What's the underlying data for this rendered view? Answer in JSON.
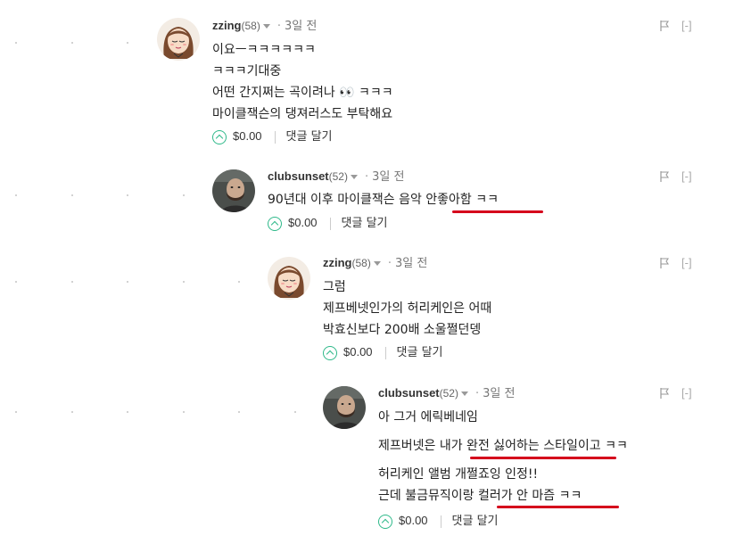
{
  "comments": [
    {
      "username": "zzing",
      "reputation": "(58)",
      "date": "3일 전",
      "collapse_label": "[-]",
      "lines": [
        "이요ㅡㅋㅋㅋㅋㅋㅋ",
        "ㅋㅋㅋ기대중",
        "어떤 간지쩌는 곡이려나 👀 ㅋㅋㅋ",
        "마이클잭슨의 댕져러스도 부탁해요"
      ],
      "payout": "$0.00",
      "reply_label": "댓글 달기",
      "avatar": "sleepy-girl-avatar"
    },
    {
      "username": "clubsunset",
      "reputation": "(52)",
      "date": "3일 전",
      "collapse_label": "[-]",
      "lines": [
        "90년대 이후 마이클잭슨 음악 안좋아함 ㅋㅋ"
      ],
      "payout": "$0.00",
      "reply_label": "댓글 달기",
      "avatar": "bearded-man-avatar"
    },
    {
      "username": "zzing",
      "reputation": "(58)",
      "date": "3일 전",
      "collapse_label": "[-]",
      "lines": [
        "그럼",
        "제프베넷인가의 허리케인은 어때",
        "박효신보다 200배 소울쩔던뎅"
      ],
      "payout": "$0.00",
      "reply_label": "댓글 달기",
      "avatar": "sleepy-girl-avatar"
    },
    {
      "username": "clubsunset",
      "reputation": "(52)",
      "date": "3일 전",
      "collapse_label": "[-]",
      "lines": [
        "아 그거 에릭베네임",
        "제프버넷은 내가 완전 싫어하는 스타일이고 ㅋㅋ",
        "허리케인 앨범 개쩔죠잉 인정!!",
        "근데 불금뮤직이랑 컬러가 안 마즘 ㅋㅋ"
      ],
      "payout": "$0.00",
      "reply_label": "댓글 달기",
      "avatar": "bearded-man-avatar"
    }
  ],
  "colors": {
    "underline": "#d5001c",
    "upvote": "#2fb98a",
    "muted": "#999999"
  },
  "icons": [
    "caret-down-icon",
    "flag-icon",
    "upvote-icon"
  ]
}
